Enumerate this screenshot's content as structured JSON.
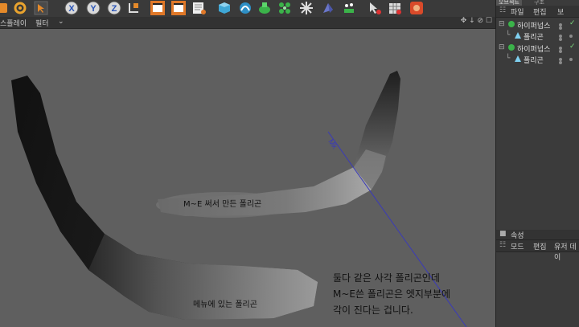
{
  "viewport": {
    "menu": [
      "스플레이",
      "필터"
    ],
    "nav_icons": "✥ ↓ ⊘ ☐"
  },
  "annotations": {
    "me_polygon": "M~E 써서 만든 폴리곤",
    "menu_polygon": "메뉴에 있는 폴리곤",
    "explanation": [
      "둘다 같은 사각 폴리곤인데",
      "M~E쓴 폴리곤은 엣지부분에",
      "각이 진다는 겁니다."
    ]
  },
  "object_manager": {
    "tab_label": "오브젝트",
    "tab2_label": "구조",
    "menu": [
      "파일",
      "편집",
      "보"
    ],
    "tree": [
      {
        "label": "하이퍼넙스",
        "type": "hypernurbs"
      },
      {
        "label": "폴리곤",
        "type": "polygon"
      },
      {
        "label": "하이퍼넙스",
        "type": "hypernurbs"
      },
      {
        "label": "폴리곤",
        "type": "polygon"
      }
    ]
  },
  "attributes": {
    "title": "속성",
    "menu": [
      "모드",
      "편집",
      "유저 데이"
    ]
  },
  "colors": {
    "viewport_bg": "#5f5f5f",
    "toolbar_bg": "#3a3a3a",
    "accent_orange": "#e07828",
    "axis_blue": "#3a3ab8"
  },
  "toolbar_icons": [
    "lock-icon",
    "refresh-icon",
    "select-icon",
    "x-axis-icon",
    "y-axis-icon",
    "z-axis-icon",
    "coord-icon",
    "render-view-icon",
    "render-picture-icon",
    "render-settings-icon",
    "cube-icon",
    "spline-icon",
    "nurbs-icon",
    "array-icon",
    "deformer-icon",
    "scene-icon",
    "light-icon",
    "brush-icon",
    "grid-icon",
    "python-icon"
  ]
}
